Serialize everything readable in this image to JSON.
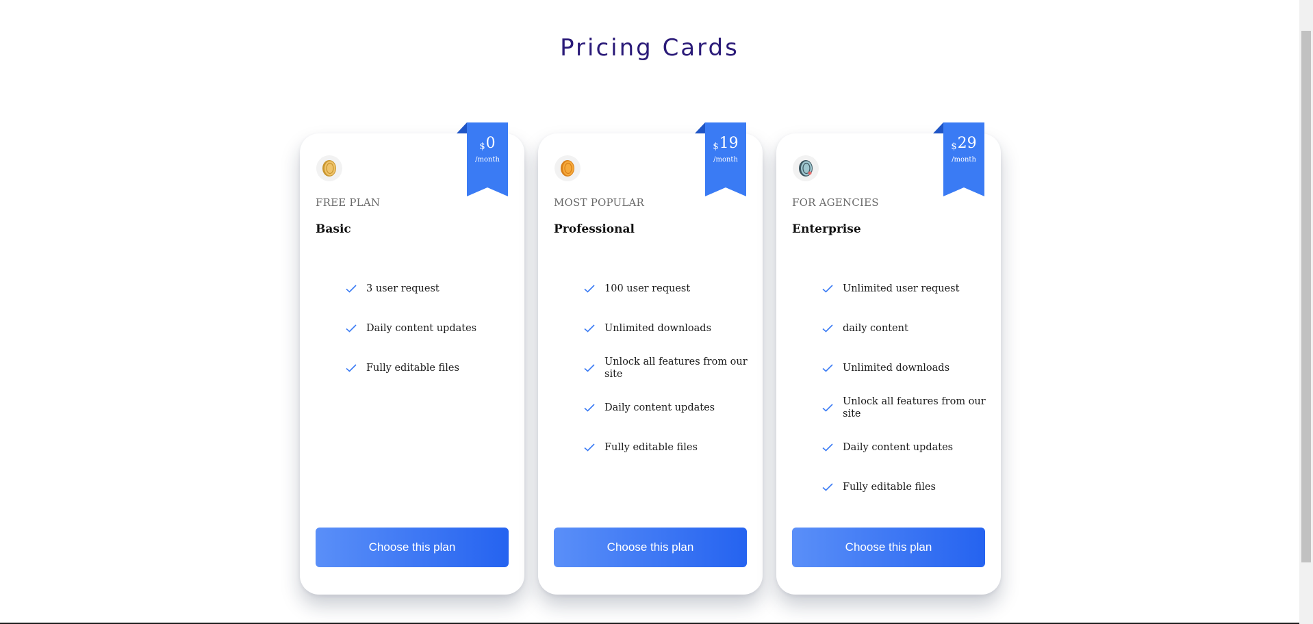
{
  "page": {
    "title": "Pricing Cards"
  },
  "colors": {
    "accent": "#3a7bf4",
    "title": "#2a1a78",
    "button_from": "#5a8ff8",
    "button_to": "#2563f0"
  },
  "cards": [
    {
      "icon": "coin-icon-gold",
      "currency": "$",
      "price": "0",
      "period": "/month",
      "tag": "FREE PLAN",
      "name": "Basic",
      "features": [
        "3 user request",
        "Daily content updates",
        "Fully editable files"
      ],
      "button": "Choose this plan"
    },
    {
      "icon": "coin-icon-orange",
      "currency": "$",
      "price": "19",
      "period": "/month",
      "tag": "MOST POPULAR",
      "name": "Professional",
      "features": [
        "100 user request",
        "Unlimited downloads",
        "Unlock all features from our site",
        "Daily content updates",
        "Fully editable files"
      ],
      "button": "Choose this plan"
    },
    {
      "icon": "coin-icon-teal",
      "currency": "$",
      "price": "29",
      "period": "/month",
      "tag": "FOR AGENCIES",
      "name": "Enterprise",
      "features": [
        "Unlimited user request",
        "daily content",
        "Unlimited downloads",
        "Unlock all features from our site",
        "Daily content updates",
        "Fully editable files"
      ],
      "button": "Choose this plan"
    }
  ]
}
